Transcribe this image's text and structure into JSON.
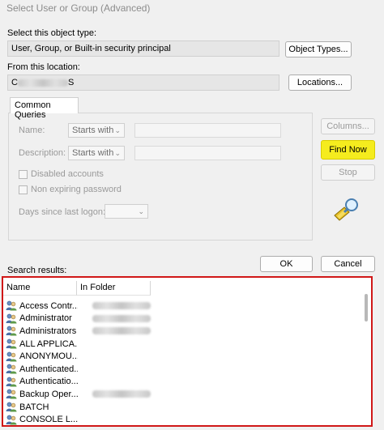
{
  "window": {
    "title": "Select User or Group (Advanced)"
  },
  "object_type": {
    "label": "Select this object type:",
    "value": "User, Group, or Built-in security principal",
    "button": "Object Types..."
  },
  "location": {
    "label": "From this location:",
    "value_prefix": "C",
    "value_suffix": "S",
    "button": "Locations..."
  },
  "queries": {
    "tab": "Common Queries",
    "name_label": "Name:",
    "name_mode": "Starts with",
    "description_label": "Description:",
    "description_mode": "Starts with",
    "disabled_accounts": "Disabled accounts",
    "non_expiring_password": "Non expiring password",
    "days_since_logon": "Days since last logon:",
    "columns_button": "Columns...",
    "find_now_button": "Find Now",
    "stop_button": "Stop"
  },
  "actions": {
    "ok": "OK",
    "cancel": "Cancel"
  },
  "results": {
    "label": "Search results:",
    "columns": [
      "Name",
      "In Folder"
    ],
    "rows": [
      {
        "name": "Access Contr...",
        "folder_blurred": true
      },
      {
        "name": "Administrator",
        "folder_blurred": true
      },
      {
        "name": "Administrators",
        "folder_blurred": true
      },
      {
        "name": "ALL APPLICA...",
        "folder_blurred": false
      },
      {
        "name": "ANONYMOU...",
        "folder_blurred": false
      },
      {
        "name": "Authenticated...",
        "folder_blurred": false
      },
      {
        "name": "Authenticatio...",
        "folder_blurred": false
      },
      {
        "name": "Backup Oper...",
        "folder_blurred": true
      },
      {
        "name": "BATCH",
        "folder_blurred": false
      },
      {
        "name": "CONSOLE L...",
        "folder_blurred": false
      },
      {
        "name": "",
        "folder_blurred": false
      }
    ]
  },
  "colors": {
    "highlight": "#f5ec1e",
    "results_border": "#d01818"
  },
  "icons": {
    "user_group": "users-icon",
    "search": "flashlight-search-icon"
  }
}
